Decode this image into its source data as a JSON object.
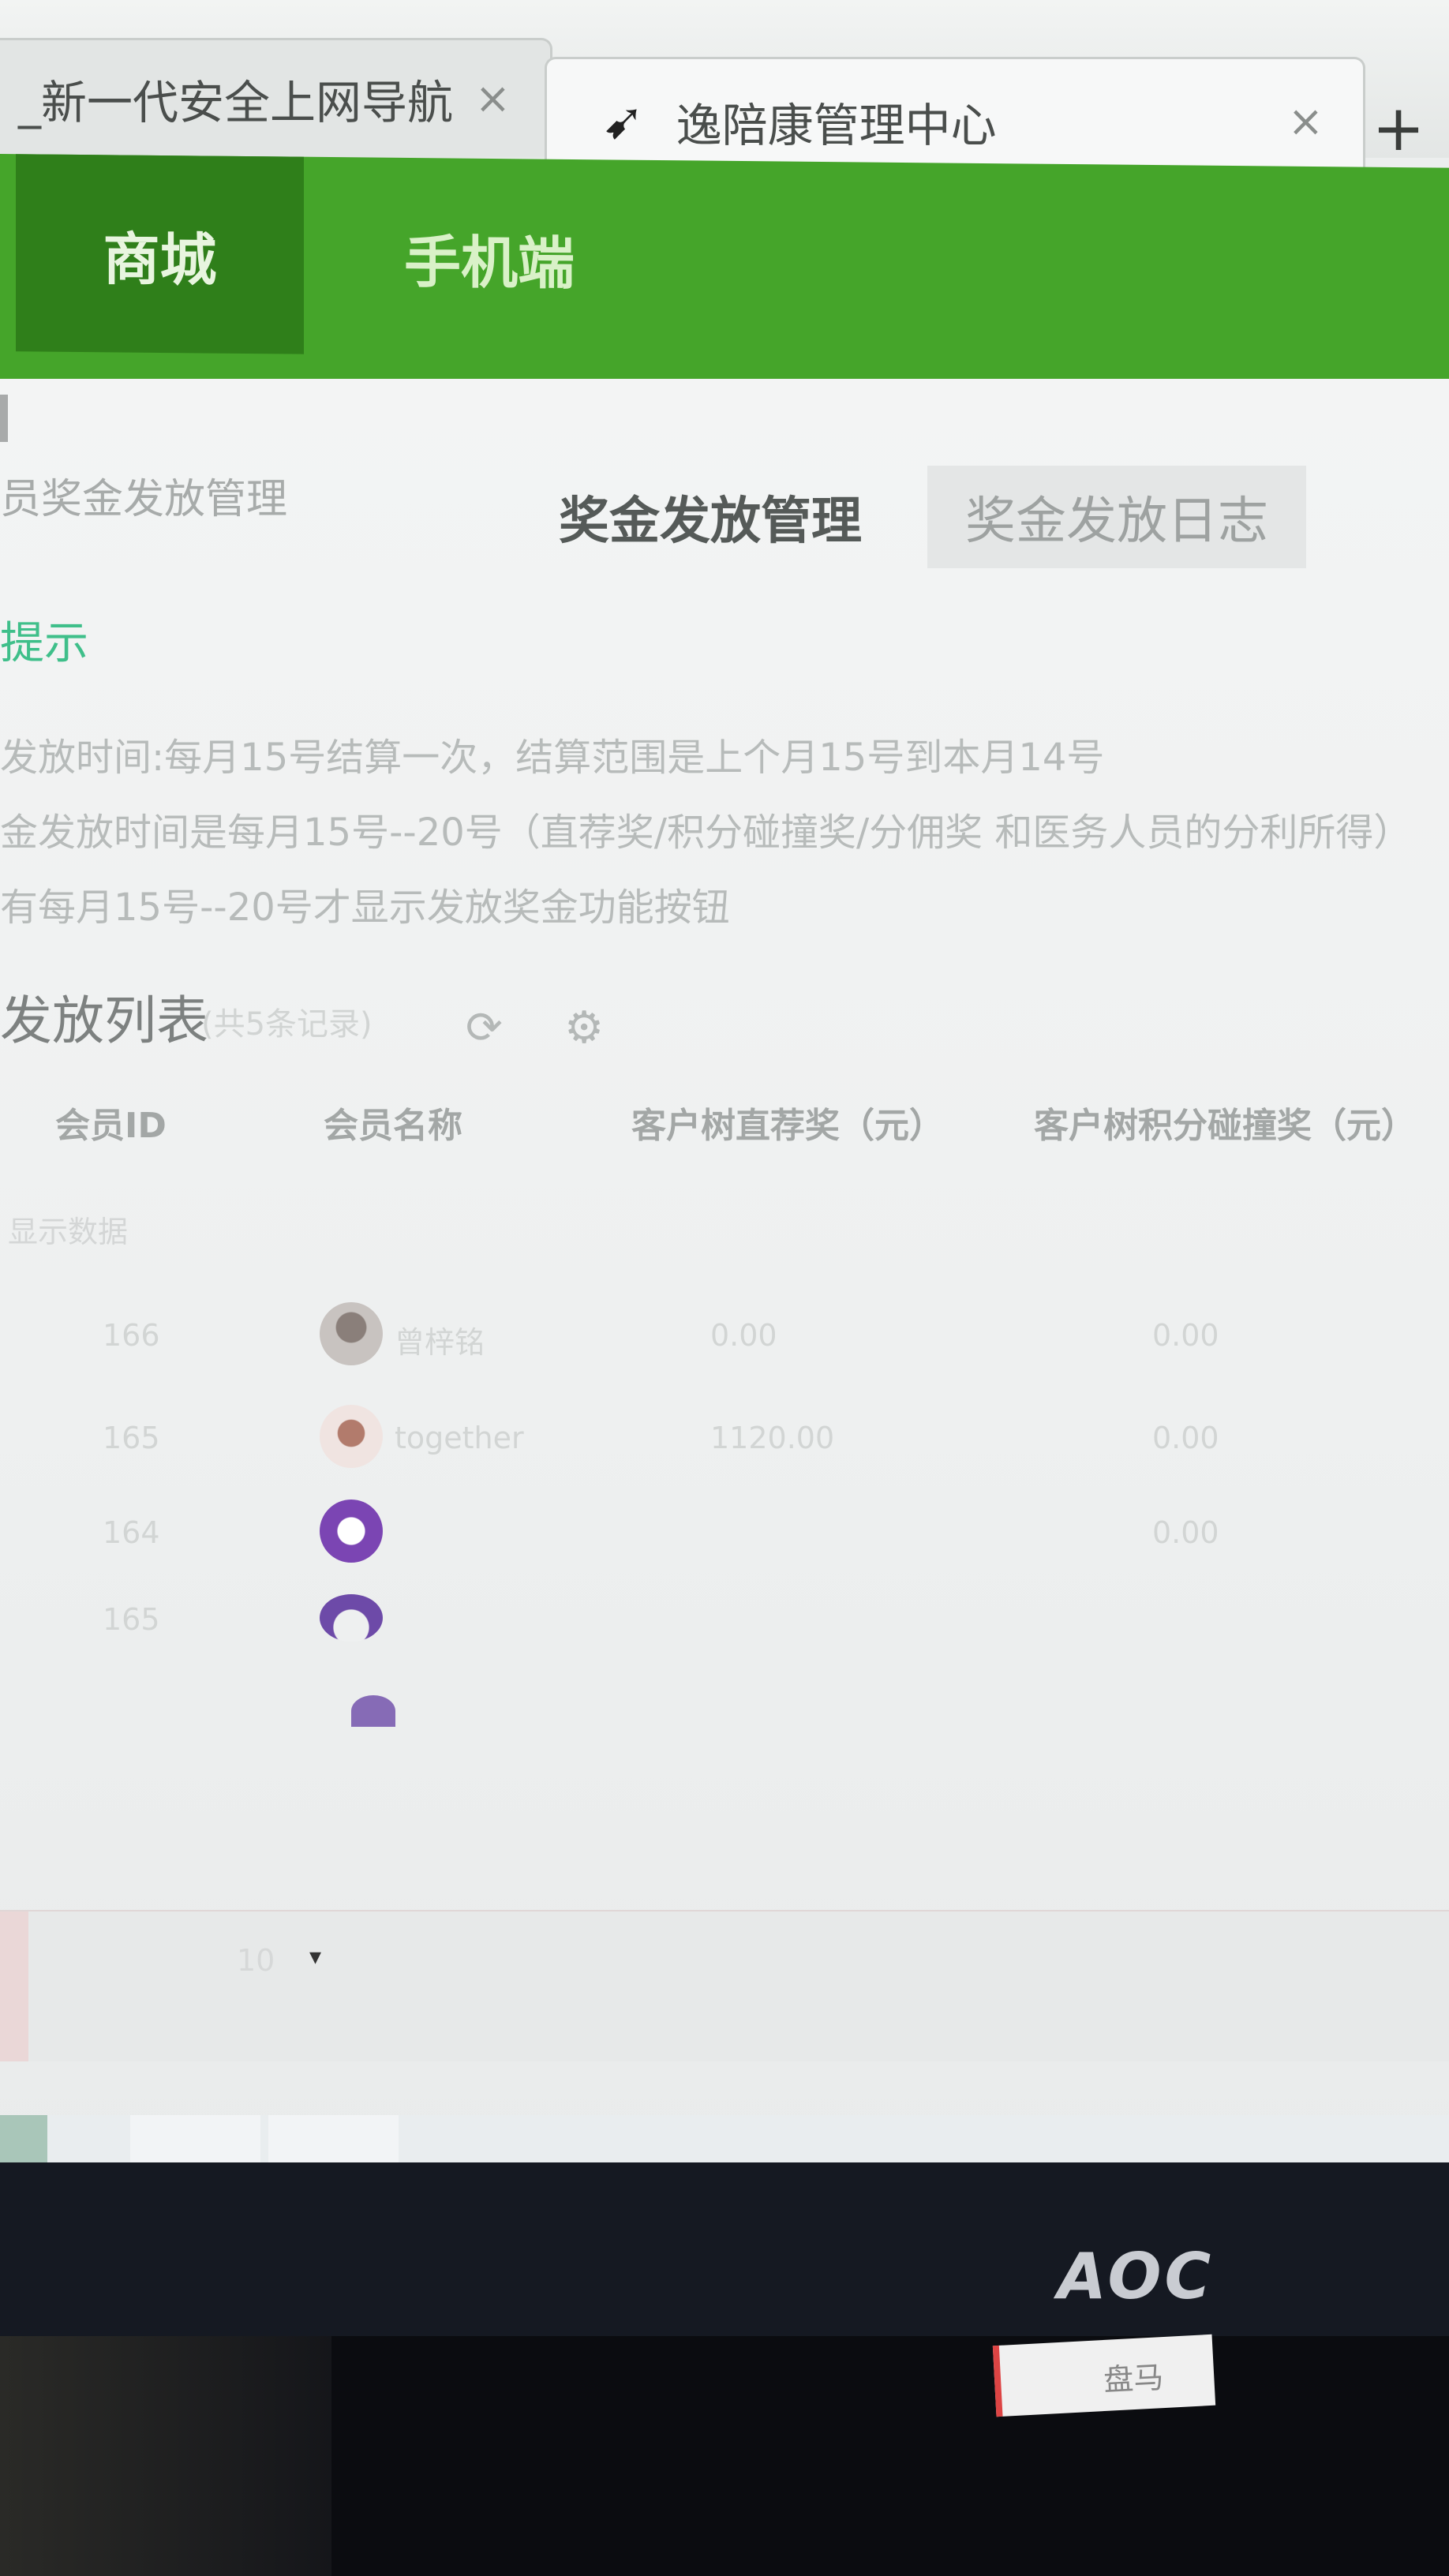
{
  "browser": {
    "tabs": [
      {
        "title": "_新一代安全上网导航",
        "close": "×"
      },
      {
        "title": "逸陪康管理中心",
        "close": "×"
      }
    ],
    "new_tab": "+"
  },
  "nav": {
    "items": [
      "商城",
      "手机端"
    ],
    "colors": {
      "bar": "#45a52a",
      "active": "#2f7f1a"
    }
  },
  "page": {
    "subtitle": "员奖金发放管理",
    "tabs": [
      "奖金发放管理",
      "奖金发放日志"
    ],
    "tips_title": "提示",
    "tips": [
      "发放时间:每月15号结算一次，结算范围是上个月15号到本月14号",
      "金发放时间是每月15号--20号（直荐奖/积分碰撞奖/分佣奖 和医务人员的分利所得）",
      "有每月15号--20号才显示发放奖金功能按钮"
    ],
    "list_title": "发放列表",
    "list_count": "(共5条记录)",
    "icons": [
      "refresh-icon",
      "settings-icon"
    ],
    "table": {
      "headers": [
        "会员ID",
        "会员名称",
        "客户树直荐奖（元）",
        "客户树积分碰撞奖（元）"
      ],
      "filter_text": "显示数据",
      "rows": [
        {
          "id": "166",
          "name": "曾梓铭",
          "rec": "0.00",
          "pts": "0.00"
        },
        {
          "id": "165",
          "name": "together",
          "rec": "1120.00",
          "pts": "0.00"
        },
        {
          "id": "164",
          "name": "",
          "rec": "",
          "pts": "0.00"
        },
        {
          "id": "165",
          "name": "",
          "rec": "",
          "pts": ""
        }
      ]
    },
    "pager": {
      "size": "10",
      "caret": "▾"
    }
  },
  "monitor": {
    "brand": "AOC",
    "sticker": "盘马"
  }
}
